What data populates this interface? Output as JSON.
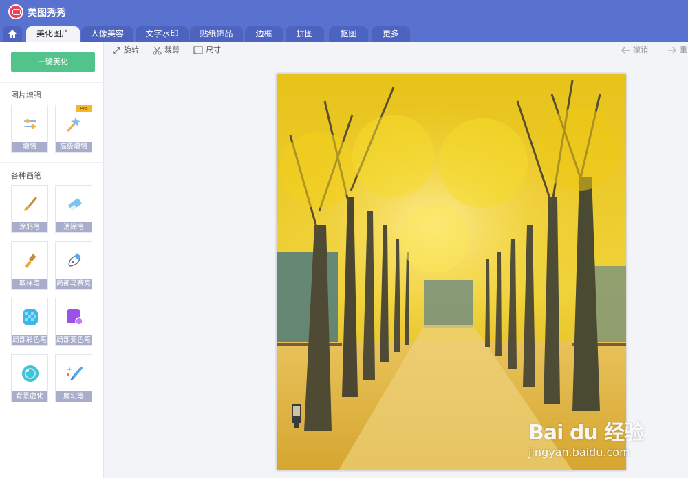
{
  "app": {
    "title": "美图秀秀"
  },
  "tabs": [
    {
      "label": "美化图片",
      "active": true
    },
    {
      "label": "人像美容",
      "active": false
    },
    {
      "label": "文字水印",
      "active": false
    },
    {
      "label": "贴纸饰品",
      "active": false
    },
    {
      "label": "边框",
      "active": false
    },
    {
      "label": "拼图",
      "active": false
    },
    {
      "label": "抠图",
      "active": false
    },
    {
      "label": "更多",
      "active": false
    }
  ],
  "sidebar": {
    "one_click_label": "一键美化",
    "enhance": {
      "title": "图片增强",
      "tools": [
        {
          "label": "增强",
          "icon": "sliders-icon"
        },
        {
          "label": "高级增强",
          "icon": "magic-wand-icon",
          "badge": "Pro"
        }
      ]
    },
    "brushes": {
      "title": "各种画笔",
      "tools": [
        {
          "label": "涂鸦笔",
          "icon": "paint-brush-icon"
        },
        {
          "label": "消除笔",
          "icon": "eraser-icon"
        },
        {
          "label": "取样笔",
          "icon": "clone-brush-icon"
        },
        {
          "label": "局部马赛克",
          "icon": "mosaic-pen-icon"
        },
        {
          "label": "局部彩色笔",
          "icon": "color-pen-icon"
        },
        {
          "label": "局部变色笔",
          "icon": "recolor-pen-icon"
        },
        {
          "label": "背景虚化",
          "icon": "blur-icon"
        },
        {
          "label": "魔幻笔",
          "icon": "magic-pen-icon"
        }
      ]
    }
  },
  "toolbar": {
    "rotate": "旋转",
    "crop": "裁剪",
    "size": "尺寸",
    "undo": "撤销",
    "redo": "重"
  },
  "watermark": {
    "logo": "Bai du 经验",
    "url": "jingyan.baidu.com"
  },
  "colors": {
    "header": "#5a72cf",
    "accent_green": "#52c38b",
    "tool_label_bg": "#a7adcb"
  }
}
